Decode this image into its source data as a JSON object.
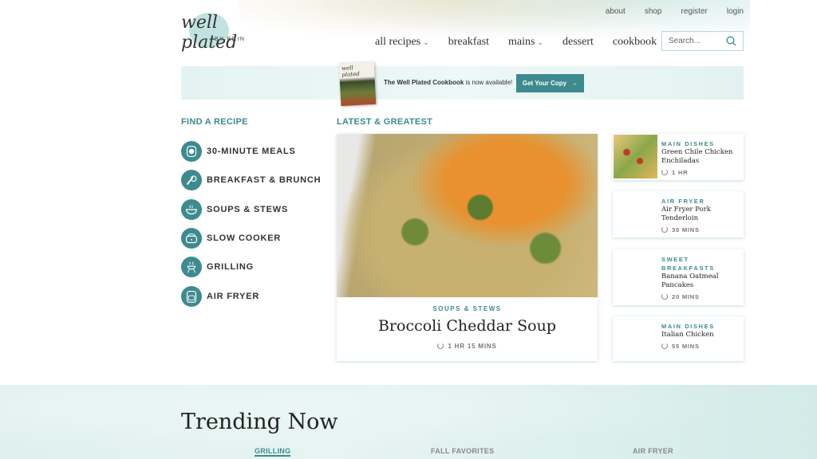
{
  "brand": {
    "logo_text": "well plated",
    "logo_sub": "BY ERIN",
    "accent": "#3d8a8f"
  },
  "utility_nav": [
    "about",
    "shop",
    "register",
    "login"
  ],
  "main_nav": [
    {
      "label": "all recipes",
      "dropdown": true
    },
    {
      "label": "breakfast",
      "dropdown": false
    },
    {
      "label": "mains",
      "dropdown": true
    },
    {
      "label": "dessert",
      "dropdown": false
    },
    {
      "label": "cookbook",
      "dropdown": false
    }
  ],
  "search": {
    "placeholder": "Search..."
  },
  "banner": {
    "cookbook_title": "The Well Plated Cookbook",
    "text": " is now available!",
    "button": "Get Your Copy",
    "book_cover_text": "well plated"
  },
  "find_recipe": {
    "heading": "FIND A RECIPE",
    "items": [
      {
        "label": "30-MINUTE MEALS",
        "icon": "timer-icon"
      },
      {
        "label": "BREAKFAST & BRUNCH",
        "icon": "breakfast-icon"
      },
      {
        "label": "SOUPS & STEWS",
        "icon": "soup-bowl-icon"
      },
      {
        "label": "SLOW COOKER",
        "icon": "slow-cooker-icon"
      },
      {
        "label": "GRILLING",
        "icon": "grill-icon"
      },
      {
        "label": "AIR FRYER",
        "icon": "air-fryer-icon"
      }
    ]
  },
  "latest": {
    "heading": "LATEST & GREATEST",
    "featured": {
      "category": "SOUPS & STEWS",
      "title": "Broccoli Cheddar Soup",
      "time": "1 HR 15 MINS"
    },
    "side": [
      {
        "category": "MAIN DISHES",
        "title": "Green Chile Chicken Enchiladas",
        "time": "1 HR"
      },
      {
        "category": "AIR FRYER",
        "title": "Air Fryer Pork Tenderloin",
        "time": "30 MINS"
      },
      {
        "category": "SWEET BREAKFASTS",
        "title": "Banana Oatmeal Pancakes",
        "time": "20 MINS"
      },
      {
        "category": "MAIN DISHES",
        "title": "Italian Chicken",
        "time": "55 MINS"
      }
    ]
  },
  "trending": {
    "heading": "Trending Now",
    "tabs": [
      "GRILLING",
      "FALL FAVORITES",
      "AIR FRYER"
    ]
  }
}
